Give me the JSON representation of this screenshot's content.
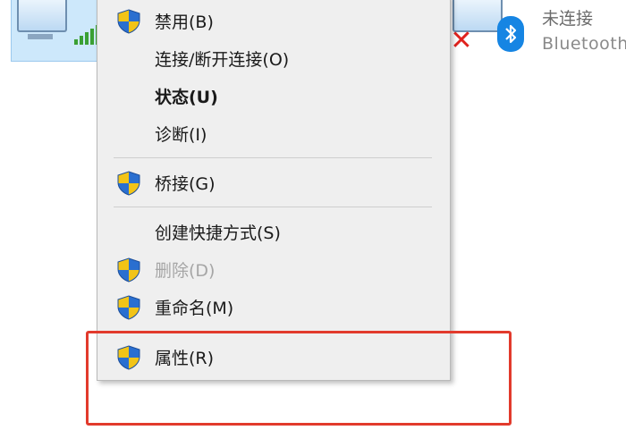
{
  "background_adapters": {
    "right_adapter": {
      "status": "未连接",
      "description": "Bluetooth"
    }
  },
  "context_menu": {
    "items": [
      {
        "label": "禁用(B)",
        "has_shield": true,
        "bold": false,
        "disabled": false
      },
      {
        "label": "连接/断开连接(O)",
        "has_shield": false,
        "bold": false,
        "disabled": false
      },
      {
        "label": "状态(U)",
        "has_shield": false,
        "bold": true,
        "disabled": false
      },
      {
        "label": "诊断(I)",
        "has_shield": false,
        "bold": false,
        "disabled": false
      },
      {
        "label": "桥接(G)",
        "has_shield": true,
        "bold": false,
        "disabled": false
      },
      {
        "label": "创建快捷方式(S)",
        "has_shield": false,
        "bold": false,
        "disabled": false
      },
      {
        "label": "删除(D)",
        "has_shield": true,
        "bold": false,
        "disabled": true
      },
      {
        "label": "重命名(M)",
        "has_shield": true,
        "bold": false,
        "disabled": false
      },
      {
        "label": "属性(R)",
        "has_shield": true,
        "bold": false,
        "disabled": false
      }
    ]
  },
  "colors": {
    "menu_background": "#efefef",
    "highlight_border": "#e23a2c",
    "shield_blue": "#2a6fd0",
    "shield_yellow": "#f2c417",
    "disabled_text": "#a6a6a6"
  },
  "icons": [
    "network-adapter-icon",
    "signal-bars-icon",
    "disabled-x-icon",
    "bluetooth-icon",
    "uac-shield-icon"
  ]
}
